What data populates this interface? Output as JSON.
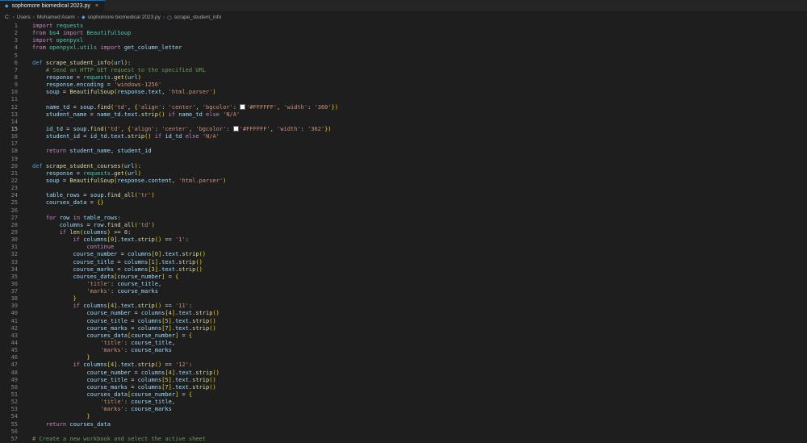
{
  "tab": {
    "filename": "sophomore biomedical 2023.py",
    "close_glyph": "×"
  },
  "breadcrumbs": {
    "items": [
      "C:",
      "Users",
      "Mohamed Asem",
      "sophomore biomedical 2023.py",
      "scrape_student_info"
    ],
    "separator": "›"
  },
  "editor": {
    "active_line": 15,
    "lines": [
      "import requests",
      "from bs4 import BeautifulSoup",
      "import openpyxl",
      "from openpyxl.utils import get_column_letter",
      "",
      "def scrape_student_info(url):",
      "    # Send an HTTP GET request to the specified URL",
      "    response = requests.get(url)",
      "    response.encoding = 'windows-1256'",
      "    soup = BeautifulSoup(response.text, 'html.parser')",
      "",
      "    name_td = soup.find('td', {'align': 'center', 'bgcolor': '#FFFFFF', 'width': '360'})",
      "    student_name = name_td.text.strip() if name_td else 'N/A'",
      "",
      "    id_td = soup.find('td', {'align': 'center', 'bgcolor': '#FFFFFF', 'width': '362'})",
      "    student_id = id_td.text.strip() if id_td else 'N/A'",
      "",
      "    return student_name, student_id",
      "",
      "def scrape_student_courses(url):",
      "    response = requests.get(url)",
      "    soup = BeautifulSoup(response.content, 'html.parser')",
      "",
      "    table_rows = soup.find_all('tr')",
      "    courses_data = {}",
      "",
      "    for row in table_rows:",
      "        columns = row.find_all('td')",
      "        if len(columns) >= 8:",
      "            if columns[0].text.strip() == '1':",
      "                continue",
      "            course_number = columns[0].text.strip()",
      "            course_title = columns[1].text.strip()",
      "            course_marks = columns[3].text.strip()",
      "            courses_data[course_number] = {",
      "                'title': course_title,",
      "                'marks': course_marks",
      "            }",
      "            if columns[4].text.strip() == '11':",
      "                course_number = columns[4].text.strip()",
      "                course_title = columns[5].text.strip()",
      "                course_marks = columns[7].text.strip()",
      "                courses_data[course_number] = {",
      "                    'title': course_title,",
      "                    'marks': course_marks",
      "                }",
      "            if columns[4].text.strip() == '12':",
      "                course_number = columns[4].text.strip()",
      "                course_title = columns[5].text.strip()",
      "                course_marks = columns[7].text.strip()",
      "                courses_data[course_number] = {",
      "                    'title': course_title,",
      "                    'marks': course_marks",
      "                }",
      "    return courses_data",
      "",
      "# Create a new workbook and select the active sheet"
    ]
  },
  "colors": {
    "background": "#1e1e1e",
    "keyword": "#c586c0",
    "def_keyword": "#569cd6",
    "function": "#dcdcaa",
    "string": "#ce9178",
    "comment": "#6a9955",
    "variable": "#9cdcfe",
    "module": "#4ec9b0",
    "line_number": "#858585"
  },
  "icons": {
    "file_type": "python-file-icon",
    "symbol": "method-symbol-icon"
  }
}
